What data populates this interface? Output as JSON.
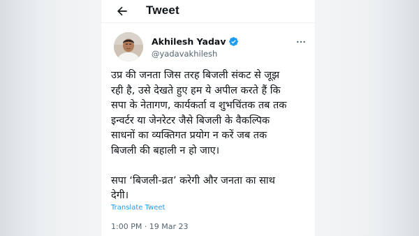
{
  "header": {
    "title": "Tweet",
    "back_icon": "arrow-left-icon"
  },
  "author": {
    "name": "Akhilesh Yadav",
    "handle": "@yadavakhilesh",
    "verified_icon": "verified-badge-icon",
    "verified_color": "#1d9bf0",
    "more_icon": "more-options-icon"
  },
  "tweet": {
    "paragraph1": [
      "उप्र की जनता जिस तरह बिजली संकट से जूझ",
      "रही है, उसे देखते हुए हम ये अपील करते हैं कि",
      "सपा के नेतागण, कार्यकर्ता व शुभचिंतक तब तक",
      "इन्वर्टर या जेनरेटर जैसे बिजली के वैकल्पिक",
      "साधनों का व्यक्तिगत प्रयोग न करें जब तक",
      "बिजली की बहाली न हो जाए।"
    ],
    "paragraph2": [
      "सपा ‘बिजली-व्रत’ करेगी और जनता का साथ",
      "देगी।"
    ],
    "translate_label": "Translate Tweet",
    "timestamp": "1:00 PM · 19 Mar 23"
  },
  "colors": {
    "text": "#0f1419",
    "secondary": "#536471",
    "accent": "#1d9bf0"
  }
}
